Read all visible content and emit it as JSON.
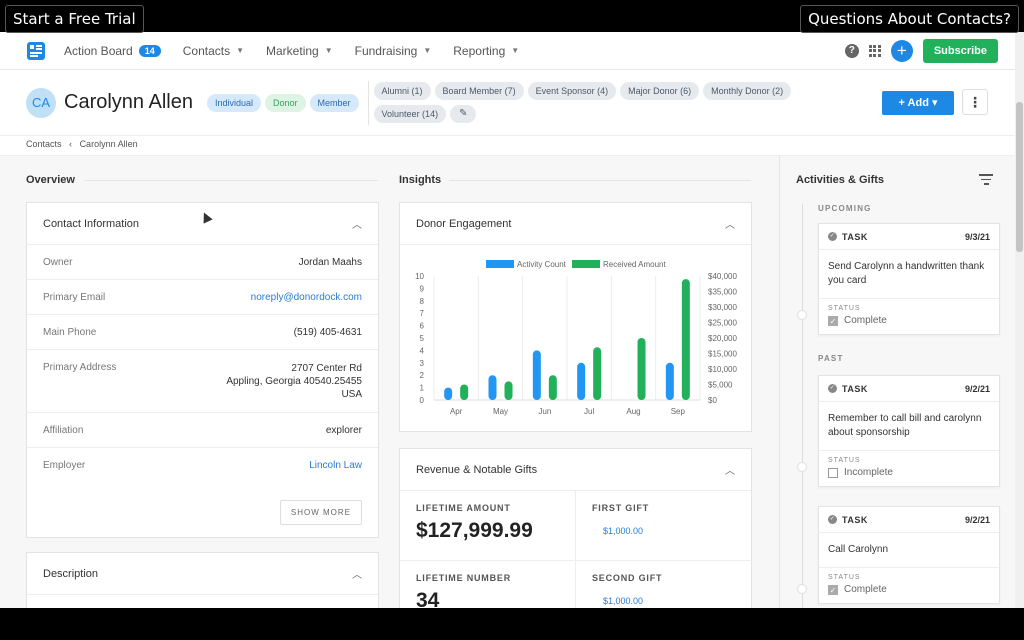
{
  "overlay": {
    "left_label": "Start a Free Trial",
    "right_label": "Questions About Contacts?"
  },
  "nav": {
    "items": [
      {
        "label": "Action Board",
        "badge": "14"
      },
      {
        "label": "Contacts"
      },
      {
        "label": "Marketing"
      },
      {
        "label": "Fundraising"
      },
      {
        "label": "Reporting"
      }
    ],
    "help": "?",
    "plus": "+",
    "subscribe_label": "Subscribe"
  },
  "contact": {
    "initials": "CA",
    "name": "Carolynn Allen",
    "types": [
      "Individual",
      "Donor",
      "Member"
    ],
    "groups": [
      "Alumni (1)",
      "Board Member (7)",
      "Event Sponsor (4)",
      "Major Donor (6)",
      "Monthly Donor (2)",
      "Volunteer (14)"
    ],
    "edit_icon": "✎",
    "add_label": "+ Add ▾",
    "more_icon": "⋮"
  },
  "breadcrumb": {
    "root": "Contacts",
    "sep": "‹",
    "current": "Carolynn Allen"
  },
  "overview": {
    "title": "Overview",
    "contact_info": {
      "title": "Contact Information",
      "rows": [
        {
          "label": "Owner",
          "value": "Jordan Maahs"
        },
        {
          "label": "Primary Email",
          "value": "noreply@donordock.com"
        },
        {
          "label": "Main Phone",
          "value": "(519) 405-4631"
        },
        {
          "label": "Primary Address",
          "value_lines": [
            "2707 Center Rd",
            "Appling, Georgia 40540.25455",
            "USA"
          ]
        },
        {
          "label": "Affiliation",
          "value": "explorer"
        },
        {
          "label": "Employer",
          "value": "Lincoln Law"
        }
      ],
      "show_more": "SHOW MORE"
    },
    "description_title": "Description"
  },
  "insights": {
    "title": "Insights",
    "engagement_title": "Donor Engagement",
    "revenue": {
      "title": "Revenue & Notable Gifts",
      "lifetime_amount_label": "LIFETIME AMOUNT",
      "lifetime_amount": "$127,999.99",
      "first_gift_label": "FIRST GIFT",
      "first_gift": "$1,000.00",
      "lifetime_number_label": "LIFETIME NUMBER",
      "lifetime_number": "34",
      "second_gift_label": "SECOND GIFT",
      "second_gift": "$1,000.00"
    }
  },
  "chart_data": {
    "type": "bar",
    "categories": [
      "Apr",
      "May",
      "Jun",
      "Jul",
      "Aug",
      "Sep"
    ],
    "series": [
      {
        "name": "Activity Count",
        "values": [
          1,
          2,
          4,
          3,
          0,
          3
        ],
        "color": "#2196f3",
        "axis": "left"
      },
      {
        "name": "Received Amount",
        "values": [
          5000,
          6000,
          8000,
          17000,
          20000,
          39000
        ],
        "color": "#20b15a",
        "axis": "right"
      }
    ],
    "ylim_left": [
      0,
      10
    ],
    "ylim_right": [
      0,
      40000
    ],
    "left_ticks": [
      "0",
      "1",
      "2",
      "3",
      "4",
      "5",
      "6",
      "7",
      "8",
      "9",
      "10"
    ],
    "right_ticks": [
      "$0",
      "$5,000",
      "$10,000",
      "$15,000",
      "$20,000",
      "$25,000",
      "$30,000",
      "$35,000",
      "$40,000"
    ],
    "legend": "top",
    "grid": true
  },
  "activities": {
    "title": "Activities & Gifts",
    "upcoming_label": "UPCOMING",
    "past_label": "PAST",
    "task_label": "TASK",
    "status_label": "STATUS",
    "items": [
      {
        "date": "9/3/21",
        "text": "Send Carolynn a handwritten thank you card",
        "status": "Complete",
        "checked": true
      },
      {
        "date": "9/2/21",
        "text": "Remember to call bill and carolynn about sponsorship",
        "status": "Incomplete",
        "checked": false
      },
      {
        "date": "9/2/21",
        "text": "Call Carolynn",
        "status": "Complete",
        "checked": true
      }
    ]
  },
  "colors": {
    "accent": "#1e88e5",
    "success": "#20b15a"
  }
}
